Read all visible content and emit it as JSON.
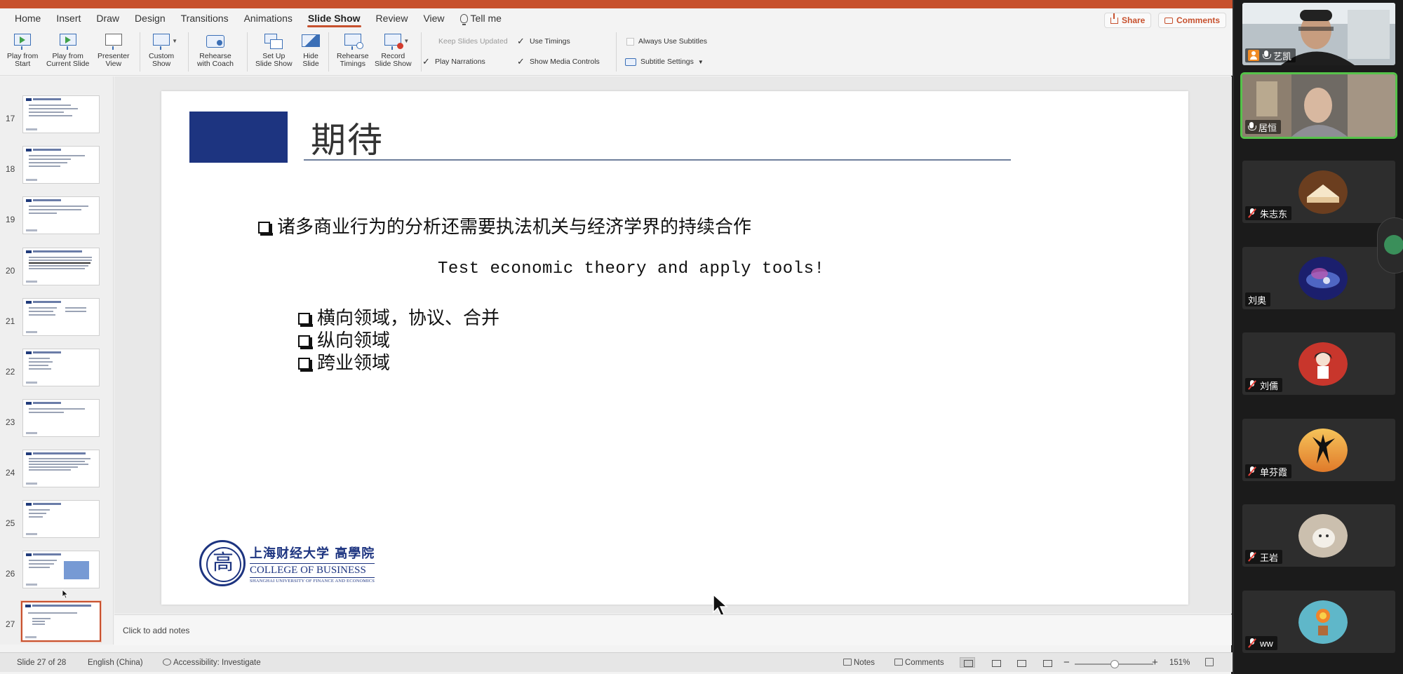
{
  "ribbon_tabs": [
    "Home",
    "Insert",
    "Draw",
    "Design",
    "Transitions",
    "Animations",
    "Slide Show",
    "Review",
    "View"
  ],
  "active_tab": "Slide Show",
  "tell_me": "Tell me",
  "share_label": "Share",
  "comments_label": "Comments",
  "ribbon": {
    "play_from_start": [
      "Play from",
      "Start"
    ],
    "play_from_current": [
      "Play from",
      "Current Slide"
    ],
    "presenter_view": [
      "Presenter",
      "View"
    ],
    "custom_show": [
      "Custom",
      "Show"
    ],
    "rehearse_coach": [
      "Rehearse",
      "with Coach"
    ],
    "setup_show": [
      "Set Up",
      "Slide Show"
    ],
    "hide_slide": [
      "Hide",
      "Slide"
    ],
    "rehearse_timings": [
      "Rehearse",
      "Timings"
    ],
    "record_show": [
      "Record",
      "Slide Show"
    ],
    "keep_updated": "Keep Slides Updated",
    "use_timings": "Use Timings",
    "play_narrations": "Play Narrations",
    "show_media_controls": "Show Media Controls",
    "always_subtitles": "Always Use Subtitles",
    "subtitle_settings": "Subtitle Settings"
  },
  "thumbnails": [
    "17",
    "18",
    "19",
    "20",
    "21",
    "22",
    "23",
    "24",
    "25",
    "26",
    "27"
  ],
  "active_thumbnail": "27",
  "slide": {
    "title": "期待",
    "bullet_main": "诸多商业行为的分析还需要执法机关与经济学界的持续合作",
    "test_line": "Test economic theory and apply tools!",
    "sub_bullets": [
      "横向领域，协议、合并",
      "纵向领域",
      "跨业领域"
    ],
    "logo_cn": "上海财经大学 高學院",
    "logo_en": "COLLEGE OF BUSINESS",
    "logo_sub": "SHANGHAI UNIVERSITY OF FINANCE AND ECONOMICS"
  },
  "notes_placeholder": "Click to add notes",
  "status": {
    "slide_count": "Slide 27 of 28",
    "language": "English (China)",
    "accessibility": "Accessibility: Investigate",
    "notes": "Notes",
    "comments": "Comments",
    "zoom": "151%",
    "zoom_fraction": 0.38
  },
  "participants": [
    {
      "name": "艺凯",
      "mic": "on",
      "host": true
    },
    {
      "name": "居恒",
      "mic": "on",
      "host": false
    },
    {
      "name": "朱志东",
      "mic": "muted",
      "host": false
    },
    {
      "name": "刘奥",
      "mic": "none",
      "host": false
    },
    {
      "name": "刘儒",
      "mic": "muted",
      "host": false
    },
    {
      "name": "单芬霞",
      "mic": "muted",
      "host": false
    },
    {
      "name": "王岩",
      "mic": "muted",
      "host": false
    },
    {
      "name": "ww",
      "mic": "muted",
      "host": false
    }
  ],
  "colors": {
    "accent": "#c7512e",
    "slide_blue": "#1d3480",
    "speaking": "#56c24a"
  }
}
